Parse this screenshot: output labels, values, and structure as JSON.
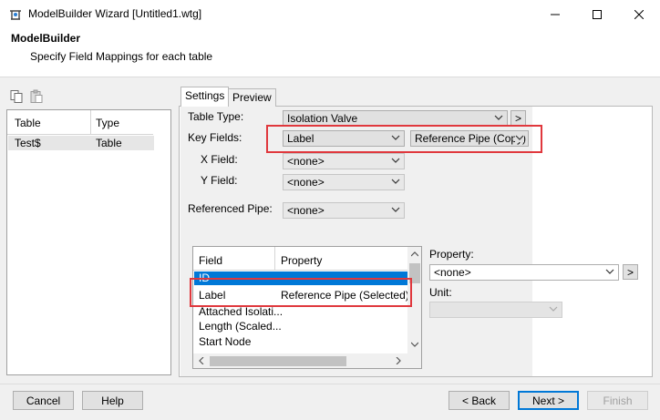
{
  "window": {
    "title": "ModelBuilder Wizard [Untitled1.wtg]",
    "controls": {
      "minimize": "minimize-icon",
      "maximize": "maximize-icon",
      "close": "close-icon"
    }
  },
  "header": {
    "title": "ModelBuilder",
    "subtitle": "Specify Field Mappings for each table"
  },
  "left_panel": {
    "columns": [
      "Table",
      "Type"
    ],
    "rows": [
      {
        "table": "Test$",
        "type": "Table"
      }
    ]
  },
  "tabs": [
    "Settings",
    "Preview"
  ],
  "settings": {
    "table_type_label": "Table Type:",
    "table_type_value": "Isolation Valve",
    "key_fields_label": "Key Fields:",
    "key_field_value": "Label",
    "key_field_ref_value": "Reference Pipe (Copy)",
    "x_field_label": "X Field:",
    "x_field_value": "<none>",
    "y_field_label": "Y Field:",
    "y_field_value": "<none>",
    "ref_pipe_label": "Referenced Pipe:",
    "ref_pipe_value": "<none>"
  },
  "field_list": {
    "columns": [
      "Field",
      "Property"
    ],
    "rows": [
      {
        "field": "ID",
        "property": ""
      },
      {
        "field": "Label",
        "property": "Reference Pipe (Selected)"
      },
      {
        "field": "Attached Isolati...",
        "property": ""
      },
      {
        "field": "Length (Scaled...",
        "property": ""
      },
      {
        "field": "Start Node",
        "property": ""
      }
    ]
  },
  "property_panel": {
    "property_label": "Property:",
    "property_value": "<none>",
    "unit_label": "Unit:",
    "unit_value": ""
  },
  "buttons": {
    "cancel": "Cancel",
    "help": "Help",
    "back": "< Back",
    "next": "Next >",
    "finish": "Finish",
    "more": ">"
  },
  "colors": {
    "accent": "#0078d7",
    "highlight_box": "#e0383d"
  }
}
